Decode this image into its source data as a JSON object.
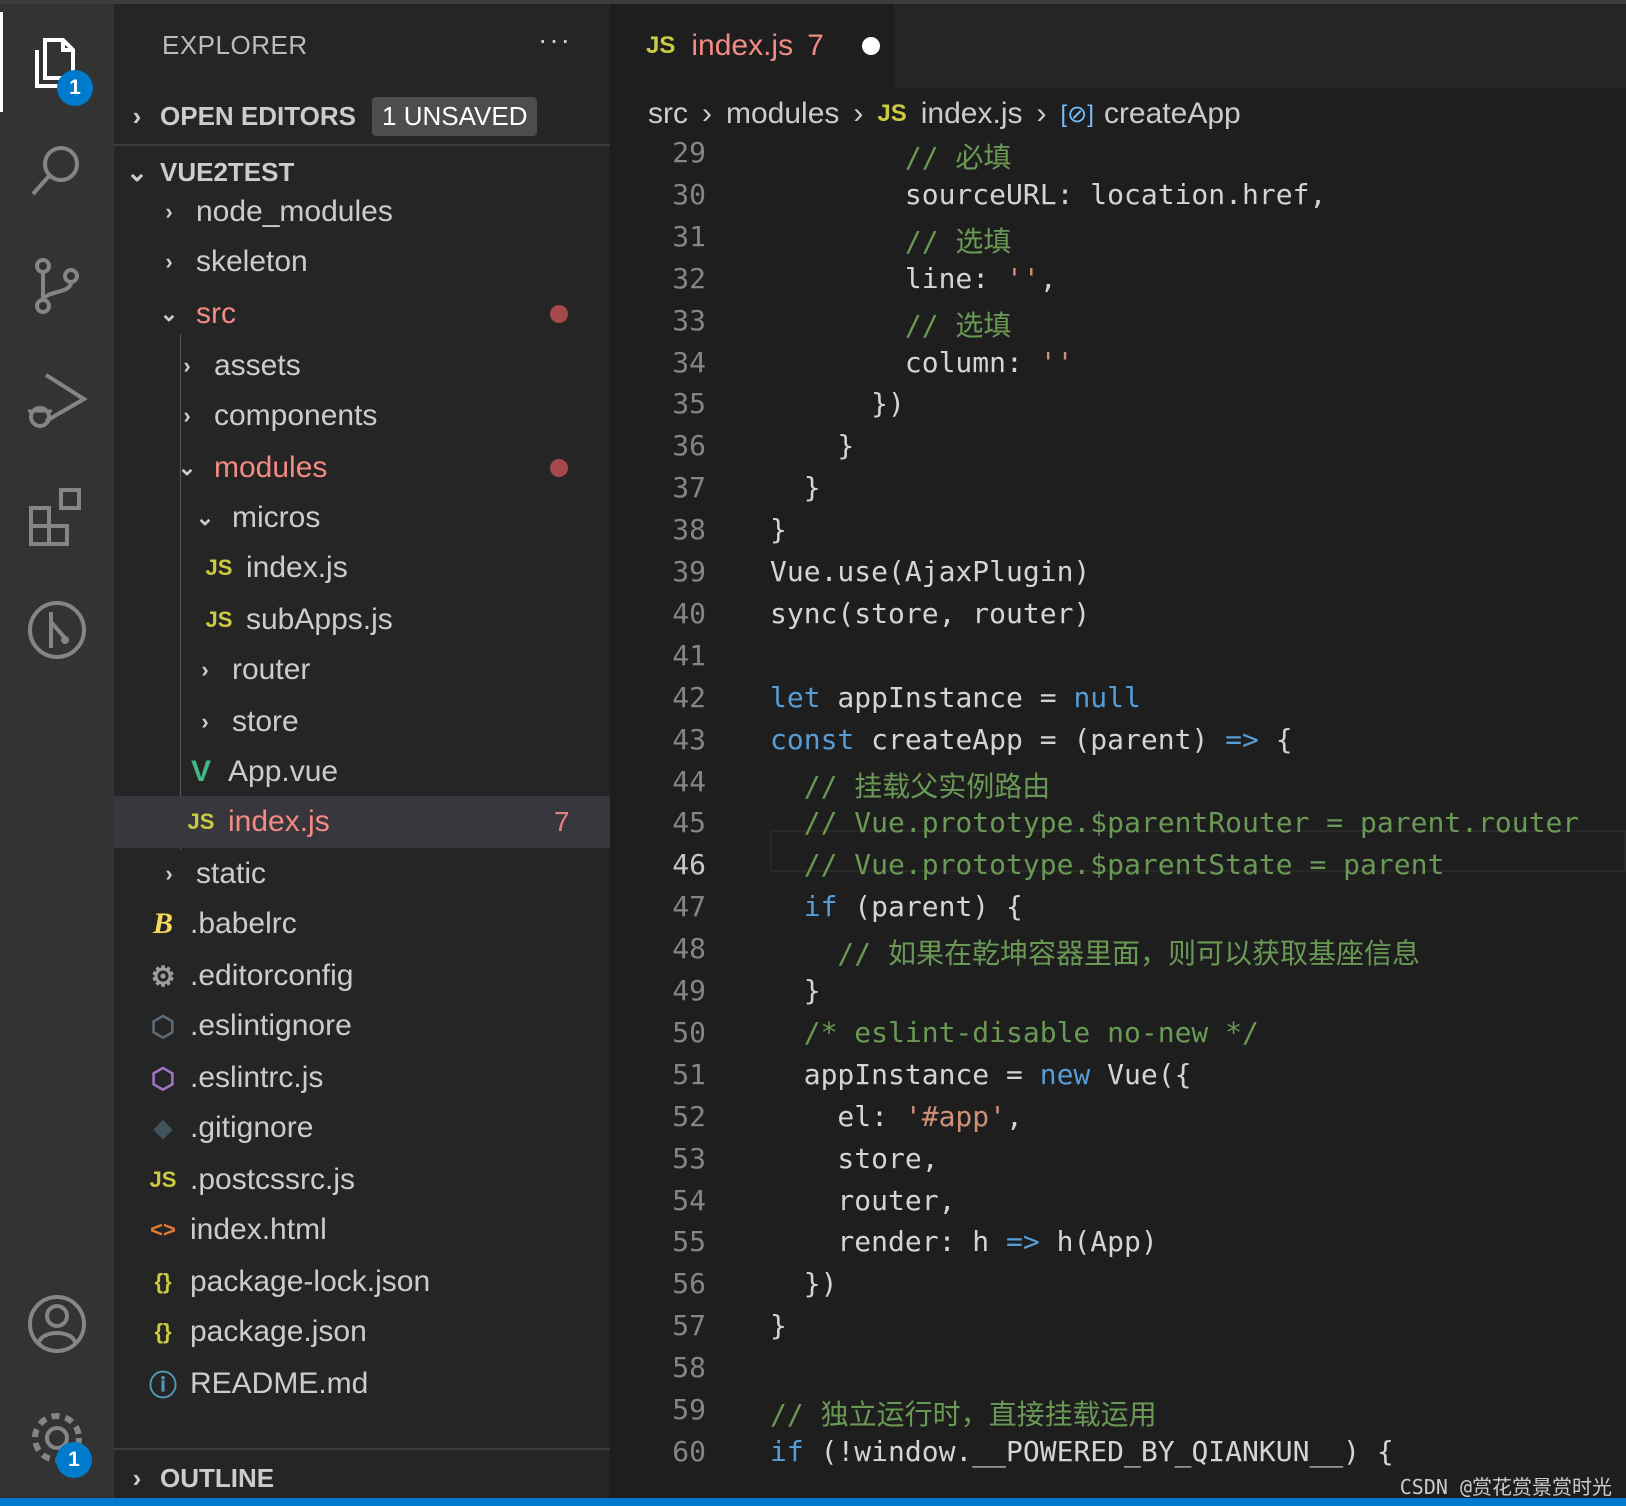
{
  "activity_bar": {
    "items": [
      {
        "icon": "files-icon",
        "badge": "1"
      },
      {
        "icon": "search-icon"
      },
      {
        "icon": "source-control-icon"
      },
      {
        "icon": "run-debug-icon"
      },
      {
        "icon": "extensions-icon"
      },
      {
        "icon": "git-graph-icon"
      }
    ],
    "bottom": [
      {
        "icon": "account-icon"
      },
      {
        "icon": "settings-gear-icon",
        "badge": "1"
      }
    ]
  },
  "explorer": {
    "title": "EXPLORER",
    "more": "···",
    "open_editors": {
      "label": "OPEN EDITORS",
      "badge": "1 UNSAVED"
    },
    "workspace": "VUE2TEST",
    "outline": "OUTLINE",
    "tree": [
      {
        "label": "node_modules",
        "type": "folder"
      },
      {
        "label": "skeleton",
        "type": "folder"
      },
      {
        "label": "src",
        "type": "folder-open"
      },
      {
        "label": "assets",
        "type": "folder"
      },
      {
        "label": "components",
        "type": "folder"
      },
      {
        "label": "modules",
        "type": "folder-open"
      },
      {
        "label": "micros",
        "type": "folder-open"
      },
      {
        "label": "index.js",
        "type": "js",
        "icon_text": "JS"
      },
      {
        "label": "subApps.js",
        "type": "js",
        "icon_text": "JS"
      },
      {
        "label": "router",
        "type": "folder"
      },
      {
        "label": "store",
        "type": "folder"
      },
      {
        "label": "App.vue",
        "type": "vue",
        "icon_text": "V"
      },
      {
        "label": "index.js",
        "type": "js",
        "icon_text": "JS",
        "problems": "7"
      },
      {
        "label": "static",
        "type": "folder"
      },
      {
        "label": ".babelrc",
        "type": "babel",
        "icon_text": "B"
      },
      {
        "label": ".editorconfig",
        "type": "gear",
        "icon_text": "⚙"
      },
      {
        "label": ".eslintignore",
        "type": "eslint",
        "icon_text": "⬡"
      },
      {
        "label": ".eslintrc.js",
        "type": "eslint",
        "icon_text": "⬡"
      },
      {
        "label": ".gitignore",
        "type": "git",
        "icon_text": "◆"
      },
      {
        "label": ".postcssrc.js",
        "type": "js",
        "icon_text": "JS"
      },
      {
        "label": "index.html",
        "type": "html",
        "icon_text": "<>"
      },
      {
        "label": "package-lock.json",
        "type": "json",
        "icon_text": "{}"
      },
      {
        "label": "package.json",
        "type": "json",
        "icon_text": "{}"
      },
      {
        "label": "README.md",
        "type": "info",
        "icon_text": "ⓘ"
      }
    ]
  },
  "tab": {
    "icon_text": "JS",
    "name": "index.js",
    "problems": "7"
  },
  "breadcrumb": [
    "src",
    "modules",
    "index.js",
    "createApp"
  ],
  "breadcrumb_js_icon": "JS",
  "breadcrumb_symbol_icon": "[⊘]",
  "code": {
    "current_line": "46",
    "lines": [
      {
        "n": "29",
        "t": "        // 必填"
      },
      {
        "n": "30",
        "t": "        sourceURL: location.href,"
      },
      {
        "n": "31",
        "t": "        // 选填"
      },
      {
        "n": "32",
        "t": "        line: '',"
      },
      {
        "n": "33",
        "t": "        // 选填"
      },
      {
        "n": "34",
        "t": "        column: ''"
      },
      {
        "n": "35",
        "t": "      })"
      },
      {
        "n": "36",
        "t": "    }"
      },
      {
        "n": "37",
        "t": "  }"
      },
      {
        "n": "38",
        "t": "}"
      },
      {
        "n": "39",
        "t": "Vue.use(AjaxPlugin)"
      },
      {
        "n": "40",
        "t": "sync(store, router)"
      },
      {
        "n": "41",
        "t": ""
      },
      {
        "n": "42",
        "t": "let appInstance = null"
      },
      {
        "n": "43",
        "t": "const createApp = (parent) => {"
      },
      {
        "n": "44",
        "t": "  // 挂载父实例路由"
      },
      {
        "n": "45",
        "t": "  // Vue.prototype.$parentRouter = parent.router"
      },
      {
        "n": "46",
        "t": "  // Vue.prototype.$parentState = parent"
      },
      {
        "n": "47",
        "t": "  if (parent) {"
      },
      {
        "n": "48",
        "t": "    // 如果在乾坤容器里面，则可以获取基座信息"
      },
      {
        "n": "49",
        "t": "  }"
      },
      {
        "n": "50",
        "t": "  /* eslint-disable no-new */"
      },
      {
        "n": "51",
        "t": "  appInstance = new Vue({"
      },
      {
        "n": "52",
        "t": "    el: '#app',"
      },
      {
        "n": "53",
        "t": "    store,"
      },
      {
        "n": "54",
        "t": "    router,"
      },
      {
        "n": "55",
        "t": "    render: h => h(App)"
      },
      {
        "n": "56",
        "t": "  })"
      },
      {
        "n": "57",
        "t": "}"
      },
      {
        "n": "58",
        "t": ""
      },
      {
        "n": "59",
        "t": "// 独立运行时，直接挂载运用"
      },
      {
        "n": "60",
        "t": "if (!window.__POWERED_BY_QIANKUN__) {"
      }
    ]
  },
  "watermark": "CSDN @赏花赏景赏时光",
  "colors": {
    "accent": "#007acc",
    "error": "#f28b82",
    "js_icon": "#cbcb41",
    "keyword": "#569cd6",
    "string": "#ce9178",
    "comment": "#6a9955"
  }
}
